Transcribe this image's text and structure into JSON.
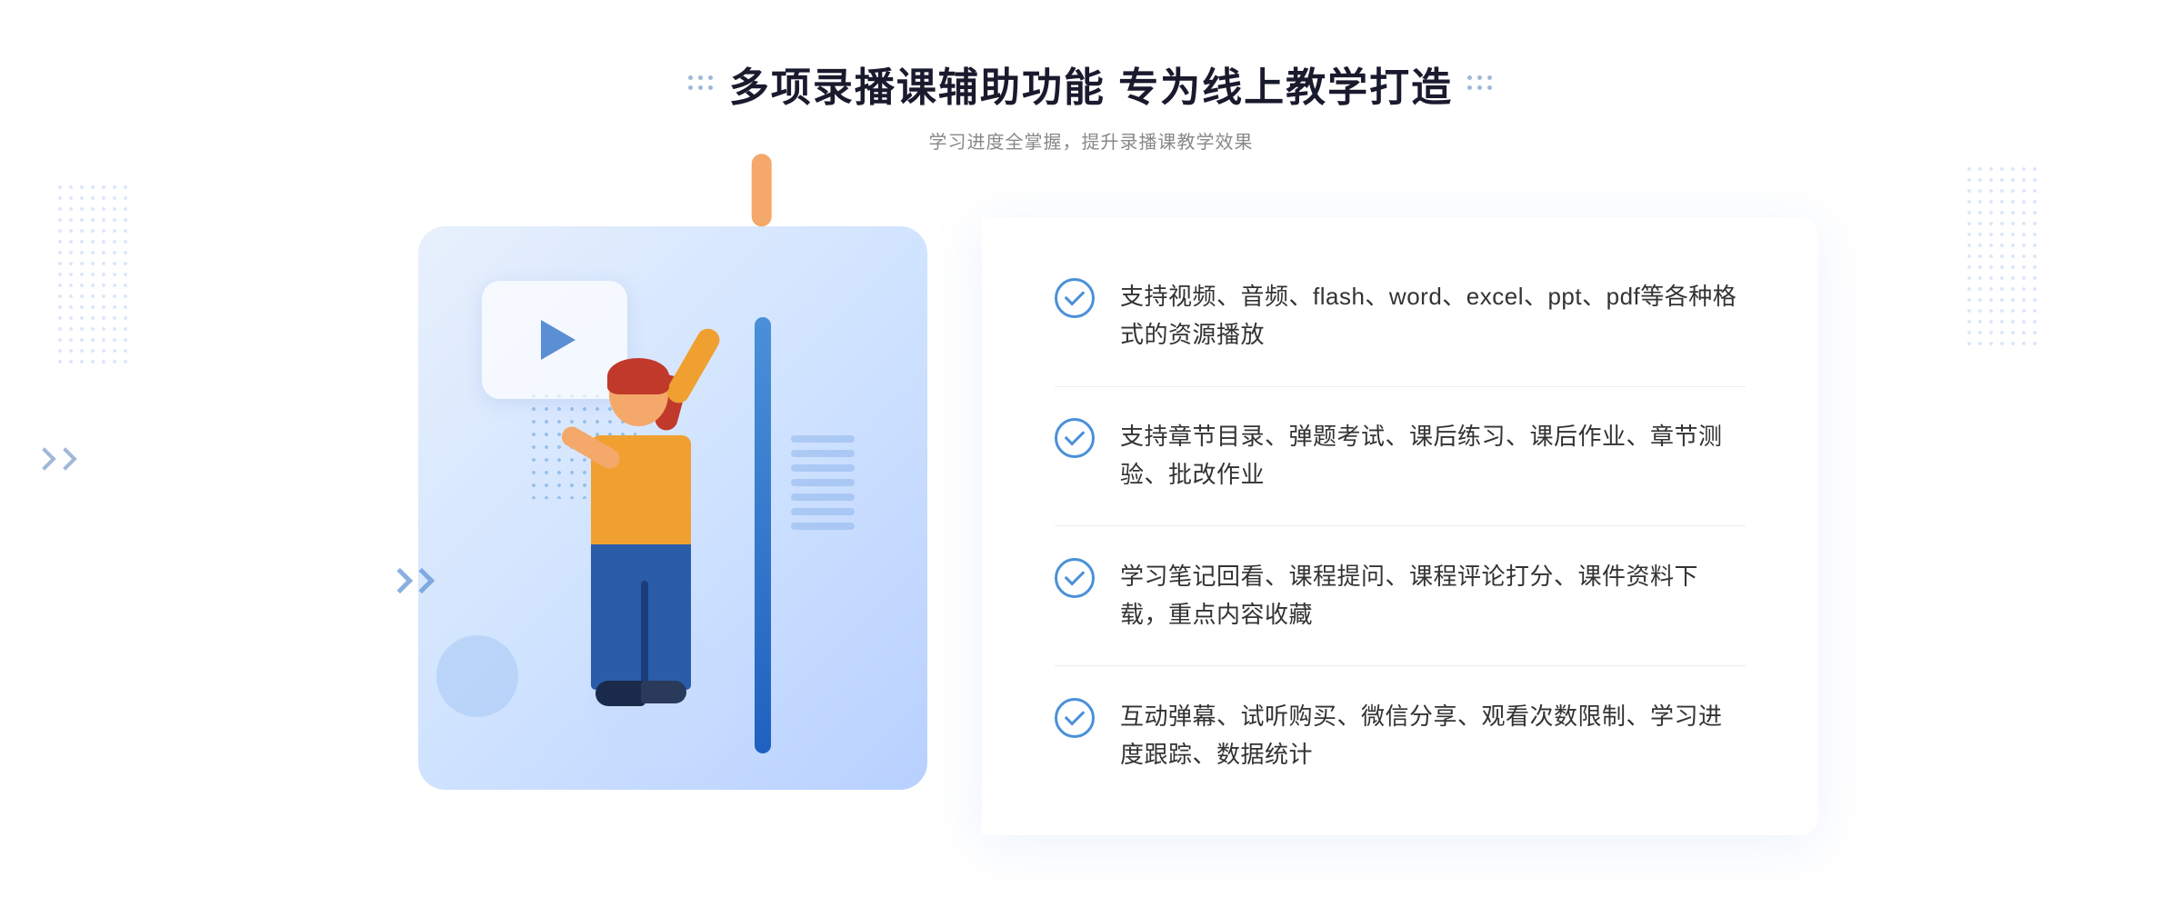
{
  "header": {
    "title": "多项录播课辅助功能 专为线上教学打造",
    "subtitle": "学习进度全掌握，提升录播课教学效果",
    "deco_left": ":::",
    "deco_right": ":::"
  },
  "features": [
    {
      "id": 1,
      "text": "支持视频、音频、flash、word、excel、ppt、pdf等各种格式的资源播放"
    },
    {
      "id": 2,
      "text": "支持章节目录、弹题考试、课后练习、课后作业、章节测验、批改作业"
    },
    {
      "id": 3,
      "text": "学习笔记回看、课程提问、课程评论打分、课件资料下载，重点内容收藏"
    },
    {
      "id": 4,
      "text": "互动弹幕、试听购买、微信分享、观看次数限制、学习进度跟踪、数据统计"
    }
  ],
  "colors": {
    "primary": "#4a90d9",
    "title_color": "#1a1a2e",
    "text_color": "#333333",
    "subtitle_color": "#888888",
    "bg_illustration": "#dde8fa",
    "bg_panel": "#ffffff"
  }
}
